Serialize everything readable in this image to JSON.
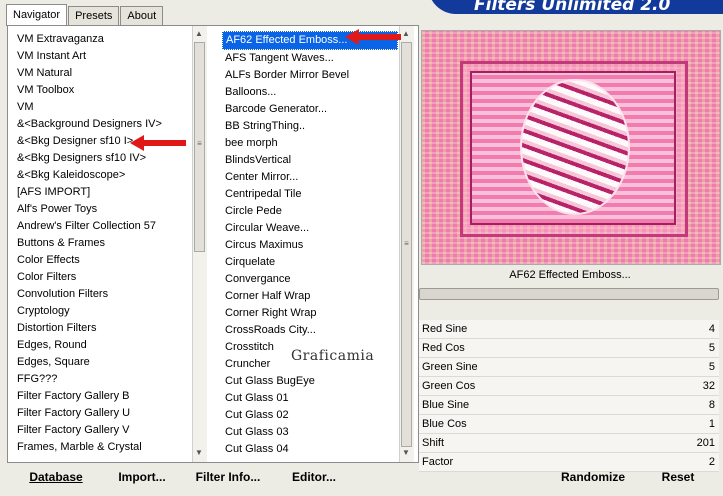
{
  "app": {
    "title": "Filters Unlimited 2.0"
  },
  "tabs": [
    "Navigator",
    "Presets",
    "About"
  ],
  "categories": [
    "VM Extravaganza",
    "VM Instant Art",
    "VM Natural",
    "VM Toolbox",
    "VM",
    "&<Background Designers IV>",
    "&<Bkg Designer sf10 I>",
    "&<Bkg Designers sf10 IV>",
    "&<Bkg Kaleidoscope>",
    "[AFS IMPORT]",
    "Alf's Power Toys",
    "Andrew's Filter Collection 57",
    "Buttons & Frames",
    "Color Effects",
    "Color Filters",
    "Convolution Filters",
    "Cryptology",
    "Distortion Filters",
    "Edges, Round",
    "Edges, Square",
    "FFG???",
    "Filter Factory Gallery B",
    "Filter Factory Gallery U",
    "Filter Factory Gallery V",
    "Frames, Marble & Crystal"
  ],
  "filters": [
    "AF62 Effected Emboss...",
    "AFS Tangent Waves...",
    "ALFs Border Mirror Bevel",
    "Balloons...",
    "Barcode Generator...",
    "BB StringThing..",
    "bee morph",
    "BlindsVertical",
    "Center Mirror...",
    "Centripedal Tile",
    "Circle Pede",
    "Circular Weave...",
    "Circus Maximus",
    "Cirquelate",
    "Convergance",
    "Corner Half Wrap",
    "Corner Right Wrap",
    "CrossRoads City...",
    "Crosstitch",
    "Cruncher",
    "Cut Glass  BugEye",
    "Cut Glass 01",
    "Cut Glass 02",
    "Cut Glass 03",
    "Cut Glass 04"
  ],
  "selected_filter": "AF62 Effected Emboss...",
  "watermark": "Graficamia",
  "params": [
    {
      "label": "Red Sine",
      "value": "4"
    },
    {
      "label": "Red Cos",
      "value": "5"
    },
    {
      "label": "Green Sine",
      "value": "5"
    },
    {
      "label": "Green Cos",
      "value": "32"
    },
    {
      "label": "Blue Sine",
      "value": "8"
    },
    {
      "label": "Blue Cos",
      "value": "1"
    },
    {
      "label": "Shift",
      "value": "201"
    },
    {
      "label": "Factor",
      "value": "2"
    }
  ],
  "buttons": {
    "database": "Database",
    "import": "Import...",
    "filter_info": "Filter Info...",
    "editor": "Editor...",
    "randomize": "Randomize",
    "reset": "Reset"
  },
  "colors": {
    "accent": "#0a64e6",
    "banner": "#123a9a",
    "arrow": "#e01818"
  }
}
